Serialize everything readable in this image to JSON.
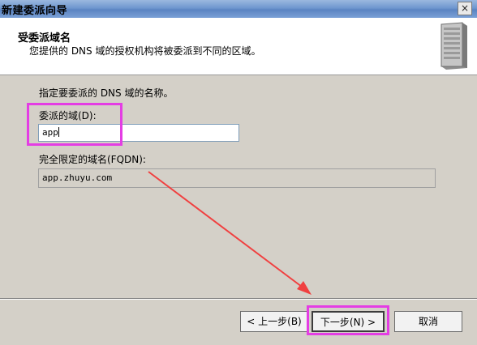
{
  "window": {
    "title": "新建委派向导",
    "close_label": "×"
  },
  "header": {
    "title": "受委派域名",
    "subtitle": "您提供的 DNS 域的授权机构将被委派到不同的区域。"
  },
  "form": {
    "instruction": "指定要委派的 DNS 域的名称。",
    "domain_label": "委派的域(D):",
    "domain_value": "app",
    "fqdn_label": "完全限定的域名(FQDN):",
    "fqdn_value": "app.zhuyu.com"
  },
  "buttons": {
    "back": "< 上一步(B)",
    "next": "下一步(N) >",
    "cancel": "取消"
  },
  "annotation": {
    "highlight_color": "#e43de4",
    "arrow_color": "#f04040"
  }
}
